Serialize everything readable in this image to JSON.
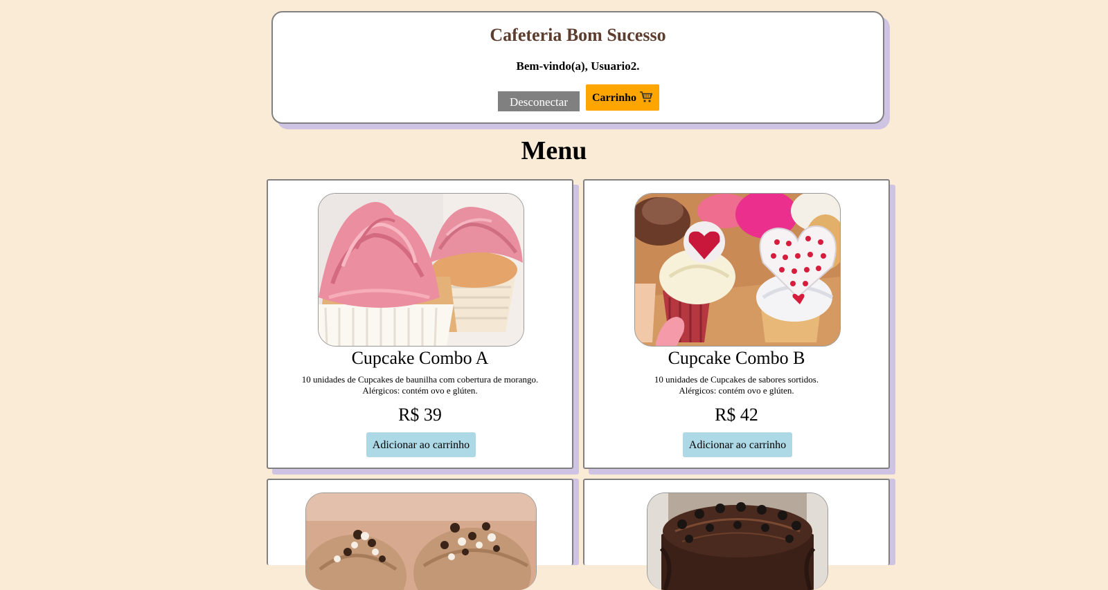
{
  "header": {
    "title": "Cafeteria Bom Sucesso",
    "welcome": "Bem-vindo(a), Usuario2.",
    "logout_label": "Desconectar",
    "cart_label": "Carrinho",
    "cart_icon": "shopping-cart-icon"
  },
  "menu": {
    "title": "Menu",
    "products": [
      {
        "name": "Cupcake Combo A",
        "description": "10 unidades de Cupcakes de baunilha com cobertura de morango.",
        "allergens": "Alérgicos: contém ovo e glúten.",
        "price": "R$ 39",
        "add_label": "Adicionar ao carrinho"
      },
      {
        "name": "Cupcake Combo B",
        "description": "10 unidades de Cupcakes de sabores sortidos.",
        "allergens": "Alérgicos: contém ovo e glúten.",
        "price": "R$ 42",
        "add_label": "Adicionar ao carrinho"
      }
    ]
  },
  "colors": {
    "page_background": "#faebd7",
    "title_brown": "#5c3d2e",
    "logout_gray": "#808080",
    "cart_orange": "#ffa500",
    "add_button_blue": "#add8e6",
    "shadow_lavender": "#cfc3e3"
  }
}
